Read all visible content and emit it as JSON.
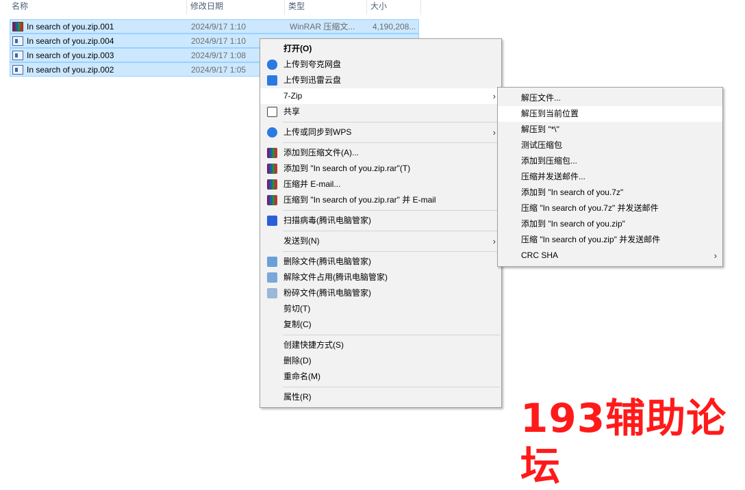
{
  "columns": [
    "名称",
    "修改日期",
    "类型",
    "大小"
  ],
  "files": [
    {
      "name": "In search of you.zip.001",
      "date": "2024/9/17 1:10",
      "type": "WinRAR 压缩文...",
      "size": "4,190,208...",
      "icon": "winrar-icon"
    },
    {
      "name": "In search of you.zip.004",
      "date": "2024/9/17 1:10",
      "type": "",
      "size": "",
      "icon": "zip-part-icon"
    },
    {
      "name": "In search of you.zip.003",
      "date": "2024/9/17 1:08",
      "type": "",
      "size": "",
      "icon": "zip-part-icon"
    },
    {
      "name": "In search of you.zip.002",
      "date": "2024/9/17 1:05",
      "type": "",
      "size": "",
      "icon": "zip-part-icon"
    }
  ],
  "context_menu": {
    "open": "打开(O)",
    "upload_quark": "上传到夸克网盘",
    "upload_xunlei": "上传到迅雷云盘",
    "sevenzip": "7-Zip",
    "share": "共享",
    "wps_sync": "上传或同步到WPS",
    "add_archive": "添加到压缩文件(A)...",
    "add_to_rar": "添加到 \"In search of you.zip.rar\"(T)",
    "compress_email": "压缩并 E-mail...",
    "compress_rar_email": "压缩到 \"In search of you.zip.rar\" 并 E-mail",
    "scan_virus": "扫描病毒(腾讯电脑管家)",
    "send_to": "发送到(N)",
    "delete_file_tx": "删除文件(腾讯电脑管家)",
    "unlock_file_tx": "解除文件占用(腾讯电脑管家)",
    "shred_file_tx": "粉碎文件(腾讯电脑管家)",
    "cut": "剪切(T)",
    "copy": "复制(C)",
    "create_shortcut": "创建快捷方式(S)",
    "delete": "删除(D)",
    "rename": "重命名(M)",
    "properties": "属性(R)"
  },
  "submenu_7zip": {
    "extract_files": "解压文件...",
    "extract_here": "解压到当前位置",
    "extract_to": "解压到 \"*\\\"",
    "test_archive": "测试压缩包",
    "add_to_archive": "添加到压缩包...",
    "compress_email": "压缩并发送邮件...",
    "add_to_7z": "添加到 \"In search of you.7z\"",
    "compress_7z_email": "压缩 \"In search of you.7z\" 并发送邮件",
    "add_to_zip": "添加到 \"In search of you.zip\"",
    "compress_zip_email": "压缩 \"In search of you.zip\" 并发送邮件",
    "crc_sha": "CRC SHA"
  },
  "watermark": "193辅助论坛",
  "colors": {
    "selection": "#cce8ff",
    "watermark": "#ff1a1a"
  }
}
